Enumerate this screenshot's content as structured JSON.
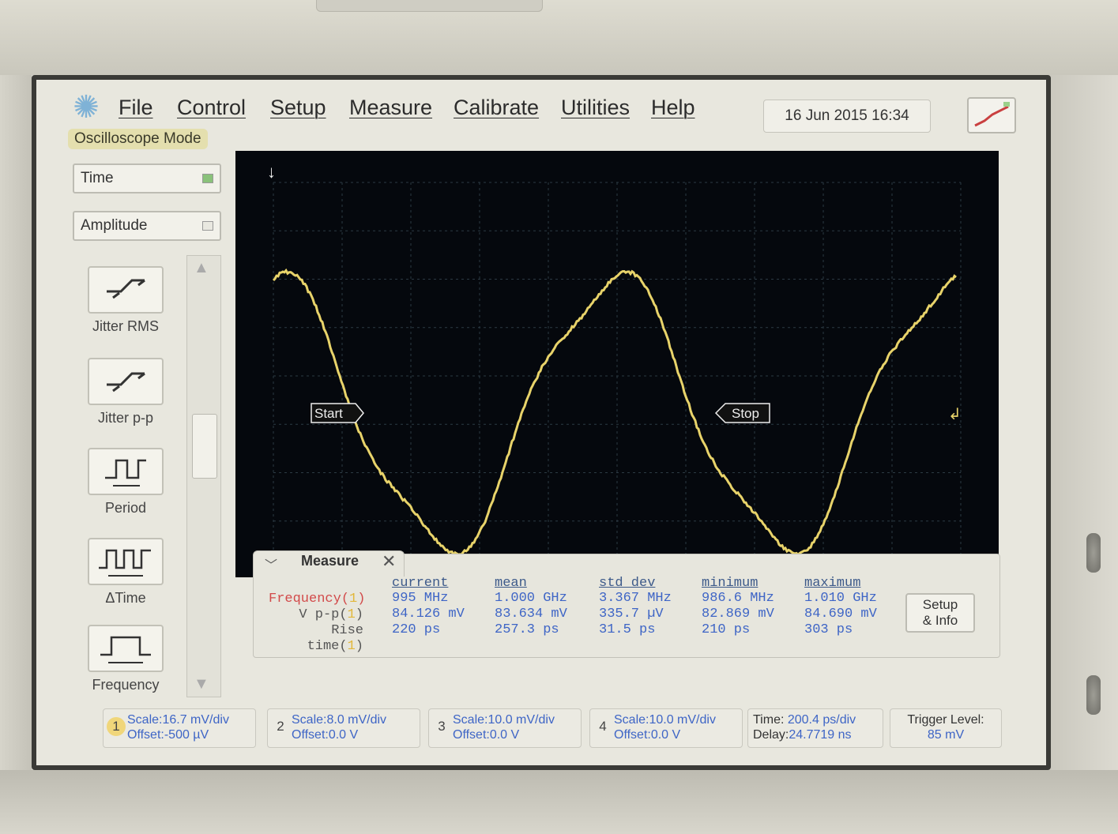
{
  "menubar": {
    "logo_icon": "sparkle-logo-icon",
    "items": [
      "File",
      "Control",
      "Setup",
      "Measure",
      "Calibrate",
      "Utilities",
      "Help"
    ],
    "datetime": "16 Jun 2015   16:34",
    "mode": "Oscilloscope Mode"
  },
  "side": {
    "time_label": "Time",
    "amplitude_label": "Amplitude",
    "tools": [
      {
        "label": "Jitter RMS",
        "icon": "jitter-rms-icon"
      },
      {
        "label": "Jitter p-p",
        "icon": "jitter-pp-icon"
      },
      {
        "label": "Period",
        "icon": "period-icon"
      },
      {
        "label": "ΔTime",
        "icon": "delta-time-icon"
      },
      {
        "label": "Frequency",
        "icon": "frequency-icon"
      }
    ]
  },
  "waveform": {
    "start_marker": "Start",
    "stop_marker": "Stop",
    "trace_color": "#e8d36a"
  },
  "measure": {
    "title": "Measure",
    "headers": [
      "current",
      "mean",
      "std dev",
      "minimum",
      "maximum"
    ],
    "rows": [
      {
        "label": "Frequency(",
        "ch": "1",
        "close": ")",
        "values": [
          "995 MHz",
          "1.000 GHz",
          "3.367 MHz",
          "986.6 MHz",
          "1.010 GHz"
        ]
      },
      {
        "label": "V p-p(",
        "ch": "1",
        "close": ")",
        "values": [
          "84.126 mV",
          "83.634 mV",
          "335.7 µV",
          "82.869 mV",
          "84.690 mV"
        ]
      },
      {
        "label": "Rise time(",
        "ch": "1",
        "close": ")",
        "values": [
          "220 ps",
          "257.3 ps",
          "31.5 ps",
          "210 ps",
          "303 ps"
        ]
      }
    ],
    "setup_line1": "Setup",
    "setup_line2": "& Info"
  },
  "status": {
    "channels": [
      {
        "num": "1",
        "scale": "Scale:16.7 mV/div",
        "offset": "Offset:-500 µV"
      },
      {
        "num": "2",
        "scale": "Scale:8.0 mV/div",
        "offset": "Offset:0.0 V"
      },
      {
        "num": "3",
        "scale": "Scale:10.0 mV/div",
        "offset": "Offset:0.0 V"
      },
      {
        "num": "4",
        "scale": "Scale:10.0 mV/div",
        "offset": "Offset:0.0 V"
      }
    ],
    "time_label": "Time:",
    "time_value": "200.4 ps/div",
    "delay_label": "Delay:",
    "delay_value": "24.7719 ns",
    "trigger_label": "Trigger Level:",
    "trigger_value": "85 mV"
  },
  "colors": {
    "accent_blue": "#3e65c6",
    "channel1_yellow": "#e2b73a",
    "screen_bg": "#05080d"
  }
}
